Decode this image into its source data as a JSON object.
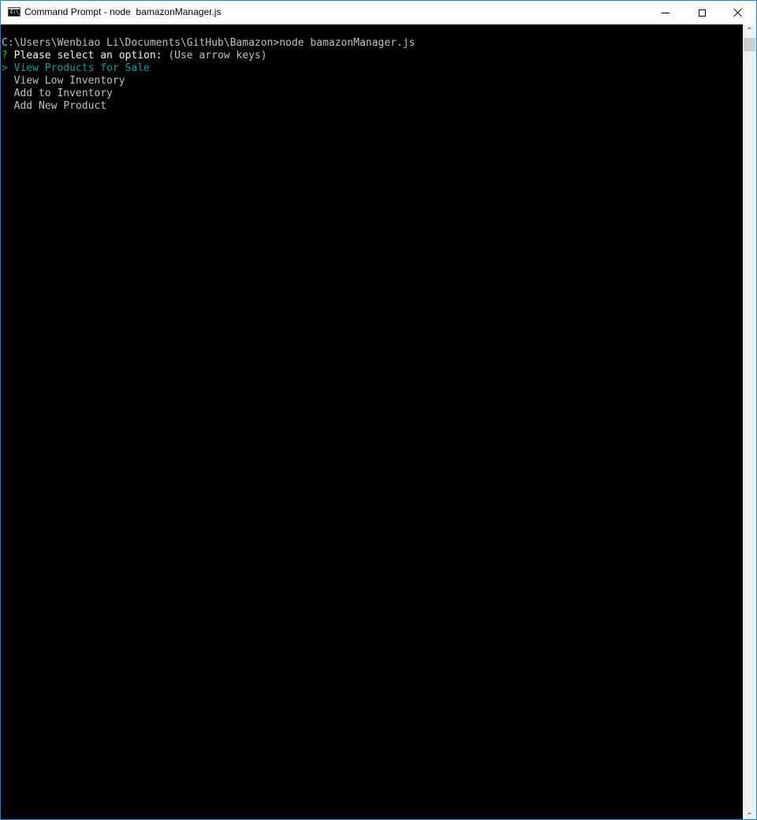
{
  "window": {
    "title": "Command Prompt - node  bamazonManager.js",
    "app_icon": "command-prompt-icon",
    "app_icon_text": "C:\\_",
    "controls": {
      "minimize": "minimize-icon",
      "maximize": "maximize-icon",
      "close": "close-icon"
    }
  },
  "console": {
    "command_line": "C:\\Users\\Wenbiao Li\\Documents\\GitHub\\Bamazon>node bamazonManager.js",
    "prompt": {
      "marker": "?",
      "question": "Please select an option:",
      "hint": "(Use arrow keys)"
    },
    "menu": {
      "pointer": ">",
      "selected_index": 0,
      "options": [
        "View Products for Sale",
        "View Low Inventory",
        "Add to Inventory",
        "Add New Product"
      ]
    },
    "colors": {
      "background": "#000000",
      "text": "#c0c0c0",
      "bright_text": "#f2f2f2",
      "prompt_marker": "#16c60c",
      "selected": "#1a9a9a"
    }
  },
  "scrollbar": {
    "up_arrow": "chevron-up-icon",
    "down_arrow": "chevron-down-icon"
  }
}
